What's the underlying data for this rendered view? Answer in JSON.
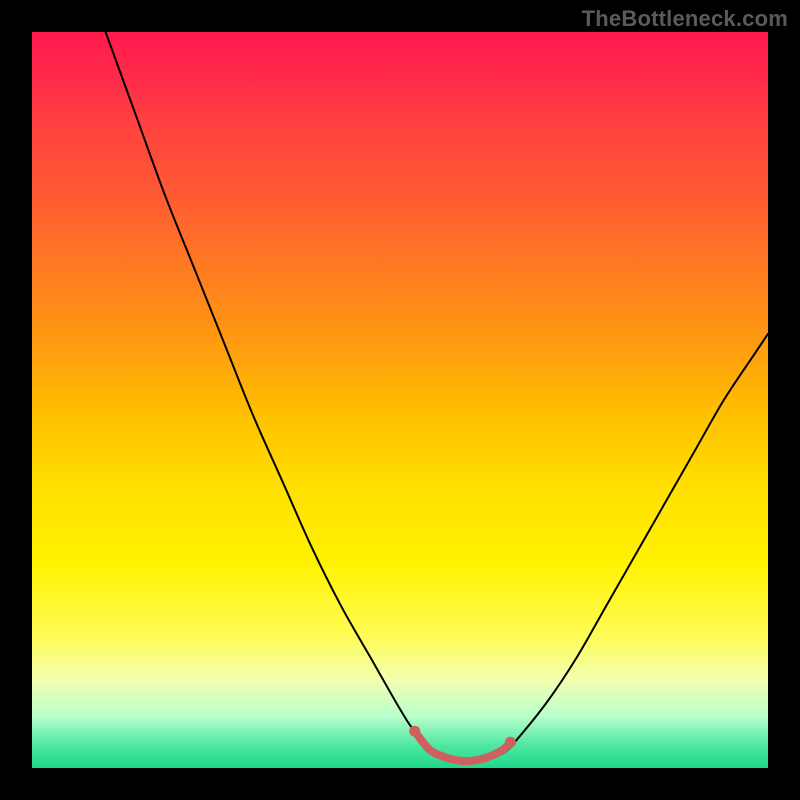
{
  "watermark": "TheBottleneck.com",
  "colors": {
    "background": "#000000",
    "curve": "#000000",
    "highlight": "#d06060",
    "gradient_top": "#ff1a4d",
    "gradient_bottom": "#1ed88a"
  },
  "chart_data": {
    "type": "line",
    "title": "",
    "xlabel": "",
    "ylabel": "",
    "xlim": [
      0,
      100
    ],
    "ylim": [
      0,
      100
    ],
    "series": [
      {
        "name": "curve",
        "x": [
          10,
          14,
          18,
          22,
          26,
          30,
          34,
          38,
          42,
          46,
          50,
          52,
          55,
          58,
          61,
          64,
          66,
          70,
          74,
          78,
          82,
          86,
          90,
          94,
          98,
          100
        ],
        "y": [
          100,
          89,
          78,
          68,
          58,
          48,
          39,
          30,
          22,
          15,
          8,
          5,
          2,
          1,
          1,
          2,
          4,
          9,
          15,
          22,
          29,
          36,
          43,
          50,
          56,
          59
        ]
      },
      {
        "name": "highlight-segment",
        "x": [
          52,
          54,
          56,
          58,
          60,
          62,
          64,
          65
        ],
        "y": [
          5,
          2.5,
          1.5,
          1.0,
          1.0,
          1.5,
          2.5,
          3.5
        ]
      }
    ],
    "annotations": []
  }
}
